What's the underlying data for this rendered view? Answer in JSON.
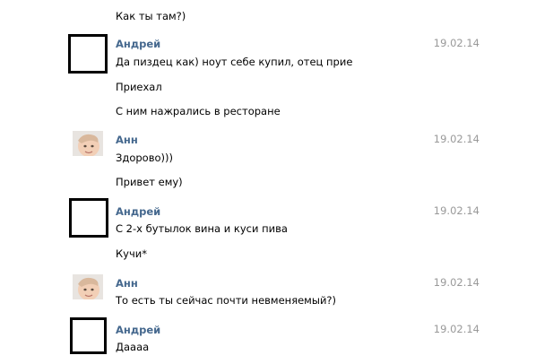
{
  "messages": [
    {
      "author": "",
      "date": "",
      "lines": [
        "Как ты там?)"
      ]
    },
    {
      "author": "Андрей",
      "date": "19.02.14",
      "lines": [
        "Да пиздец как) ноут себе купил, отец прие",
        "Приехал",
        "С ним нажрались в ресторане"
      ]
    },
    {
      "author": "Анн",
      "date": "19.02.14",
      "lines": [
        "Здорово)))",
        "Привет ему)"
      ]
    },
    {
      "author": "Андрей",
      "date": "19.02.14",
      "lines": [
        "С 2-х бутылок вина и куси пива",
        "Кучи*"
      ]
    },
    {
      "author": "Анн",
      "date": "19.02.14",
      "lines": [
        "То есть ты сейчас почти невменяемый?)"
      ]
    },
    {
      "author": "Андрей",
      "date": "19.02.14",
      "lines": [
        "Даааа"
      ]
    }
  ],
  "colors": {
    "author_link": "#45688e",
    "date": "#999999",
    "divider": "#e7e8ec",
    "text": "#000000"
  },
  "icons": {
    "andrey_avatar": "blank-square-avatar-icon",
    "ann_avatar": "baby-photo-avatar"
  }
}
